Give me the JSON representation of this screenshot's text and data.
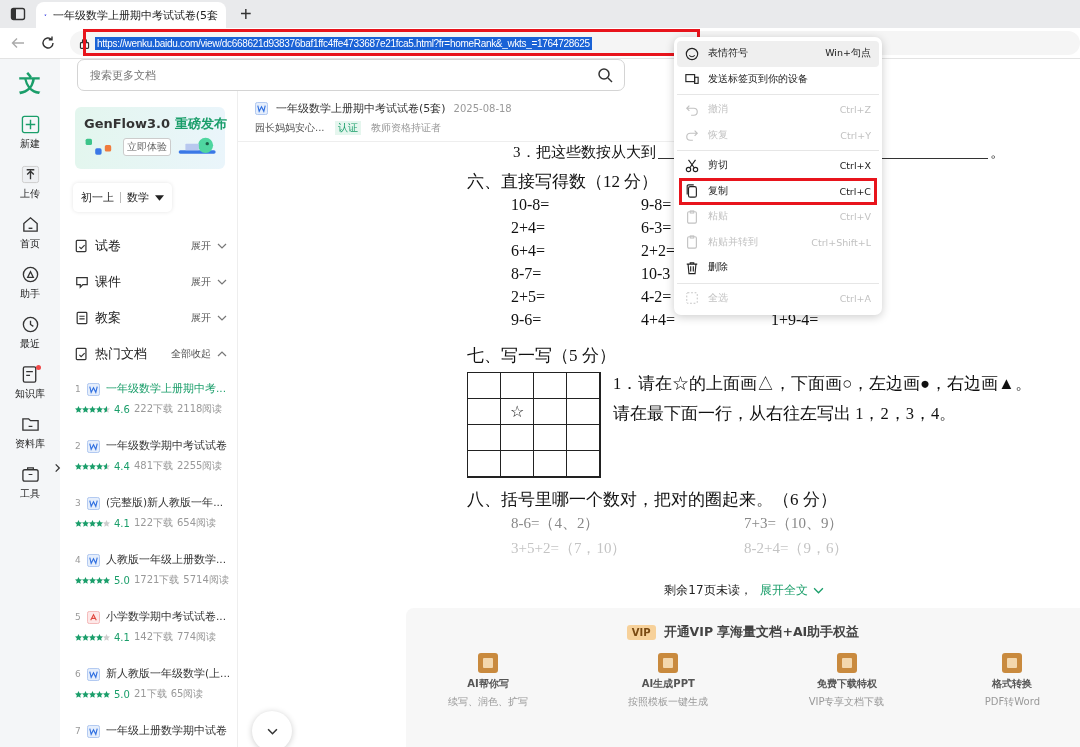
{
  "browser": {
    "tab": {
      "title": "一年级数学上册期中考试试卷(5套"
    },
    "new_tab": "+",
    "address": {
      "url": "https://wenku.baidu.com/view/dc668621d938376baf1ffc4ffe4733687e21fca5.html?fr=homeRank&_wkts_=1764728625",
      "selected": true,
      "annotated": true
    }
  },
  "logo": "文",
  "rail": [
    {
      "label": "新建",
      "dot": false
    },
    {
      "label": "上传",
      "dot": false
    },
    {
      "label": "首页",
      "dot": false
    },
    {
      "label": "助手",
      "dot": false
    },
    {
      "label": "最近",
      "dot": false
    },
    {
      "label": "知识库",
      "dot": true
    },
    {
      "label": "资料库",
      "dot": false
    },
    {
      "label": "工具",
      "dot": false
    }
  ],
  "search": {
    "placeholder": "搜索更多文档"
  },
  "banner": {
    "title": "GenFlow3.0",
    "highlight": "重磅发布",
    "button": "立即体验"
  },
  "filter": {
    "grade": "初一上",
    "subject": "数学"
  },
  "categories": [
    {
      "label": "试卷",
      "action": "展开",
      "expanded": false
    },
    {
      "label": "课件",
      "action": "展开",
      "expanded": false
    },
    {
      "label": "教案",
      "action": "展开",
      "expanded": false
    },
    {
      "label": "热门文档",
      "action": "全部收起",
      "expanded": true
    }
  ],
  "hot_docs": [
    {
      "rank": "1",
      "kind": "word",
      "title": "一年级数学上册期中考...",
      "stars": 4.5,
      "score": "4.6",
      "downloads": "222下载",
      "reads": "2118阅读",
      "selected": true
    },
    {
      "rank": "2",
      "kind": "word",
      "title": "一年级数学期中考试试卷",
      "stars": 4.5,
      "score": "4.4",
      "downloads": "481下载",
      "reads": "2255阅读",
      "selected": false
    },
    {
      "rank": "3",
      "kind": "word",
      "title": "(完整版)新人教版一年...",
      "stars": 4,
      "score": "4.1",
      "downloads": "122下载",
      "reads": "654阅读",
      "selected": false
    },
    {
      "rank": "4",
      "kind": "word",
      "title": "人教版一年级上册数学...",
      "stars": 5,
      "score": "5.0",
      "downloads": "1721下载",
      "reads": "5714阅读",
      "selected": false
    },
    {
      "rank": "5",
      "kind": "pdf",
      "title": "小学数学期中考试试卷...",
      "stars": 4,
      "score": "4.1",
      "downloads": "142下载",
      "reads": "774阅读",
      "selected": false
    },
    {
      "rank": "6",
      "kind": "word",
      "title": "新人教版一年级数学(上...",
      "stars": 5,
      "score": "5.0",
      "downloads": "21下载",
      "reads": "65阅读",
      "selected": false
    },
    {
      "rank": "7",
      "kind": "word",
      "title": "一年级上册数学期中试卷",
      "selected": false
    }
  ],
  "document": {
    "title": "一年级数学上册期中考试试卷(5套)",
    "date": "2025-08-18",
    "author": "园长妈妈安心...",
    "badge": "认证",
    "credential": "教师资格持证者",
    "cut_question": {
      "text": "3．把这些数按从大到",
      "end": "。"
    },
    "arithmetic": {
      "heading": "六、直接写得数（12 分）",
      "rows": [
        [
          "10-8=",
          "9-8="
        ],
        [
          "2+4=",
          "6-3="
        ],
        [
          "6+4=",
          "2+2="
        ],
        [
          "8-7=",
          "10-3"
        ],
        [
          "2+5=",
          "4-2="
        ],
        [
          "9-6=",
          "4+4=",
          "1+9-4="
        ]
      ]
    },
    "drawing": {
      "heading": "七、写一写（5 分）",
      "grid": [
        [
          {
            "kind": "empty"
          },
          {
            "kind": "empty"
          },
          {
            "kind": "empty"
          },
          {
            "kind": "empty"
          }
        ],
        [
          {
            "kind": "empty"
          },
          {
            "kind": "mark",
            "text": "☆"
          },
          {
            "kind": "empty"
          },
          {
            "kind": "empty"
          }
        ],
        [
          {
            "kind": "empty"
          },
          {
            "kind": "empty"
          },
          {
            "kind": "empty"
          },
          {
            "kind": "empty"
          }
        ],
        [
          {
            "kind": "empty"
          },
          {
            "kind": "empty"
          },
          {
            "kind": "empty"
          },
          {
            "kind": "empty"
          }
        ]
      ],
      "lines": [
        "1．请在☆的上面画△，下面画○，左边画●，右边画▲。",
        "请在最下面一行，从右往左写出 1，2，3，4。"
      ]
    },
    "choice": {
      "heading": "八、括号里哪一个数对，把对的圈起来。（6 分）",
      "rows": [
        [
          "8-6=（4、2）",
          "7+3=（10、9）"
        ],
        [
          "3+5+2=（7，10）",
          "8-2+4=（9，6）"
        ]
      ]
    }
  },
  "more": {
    "text": "剩余17页未读，",
    "link": "展开全文"
  },
  "vip": {
    "badge": "VIP",
    "title": "开通VIP 享海量文档+AI助手权益",
    "features": [
      {
        "title": "AI帮你写",
        "subtitle": "续写、润色、扩写"
      },
      {
        "title": "AI生成PPT",
        "subtitle": "按照模板一键生成"
      },
      {
        "title": "免费下载特权",
        "subtitle": "VIP专享文档下载"
      },
      {
        "title": "格式转换",
        "subtitle": "PDF转Word"
      }
    ]
  },
  "context_menu": [
    {
      "kind": "item",
      "label": "表情符号",
      "shortcut": "Win+句点",
      "disabled": false,
      "selected": true,
      "annotated": false
    },
    {
      "kind": "item",
      "label": "发送标签页到你的设备",
      "disabled": false,
      "selected": false,
      "annotated": false
    },
    {
      "kind": "separator"
    },
    {
      "kind": "item",
      "label": "撤消",
      "shortcut": "Ctrl+Z",
      "disabled": true,
      "selected": false,
      "annotated": false
    },
    {
      "kind": "item",
      "label": "恢复",
      "shortcut": "Ctrl+Y",
      "disabled": true,
      "selected": false,
      "annotated": false
    },
    {
      "kind": "separator"
    },
    {
      "kind": "item",
      "label": "剪切",
      "shortcut": "Ctrl+X",
      "disabled": false,
      "selected": false,
      "annotated": false
    },
    {
      "kind": "item",
      "label": "复制",
      "shortcut": "Ctrl+C",
      "disabled": false,
      "selected": false,
      "annotated": true
    },
    {
      "kind": "item",
      "label": "粘贴",
      "shortcut": "Ctrl+V",
      "disabled": true,
      "selected": false,
      "annotated": false
    },
    {
      "kind": "item",
      "label": "粘贴并转到",
      "shortcut": "Ctrl+Shift+L",
      "disabled": true,
      "selected": false,
      "annotated": false
    },
    {
      "kind": "item",
      "label": "删除",
      "disabled": false,
      "selected": false,
      "annotated": false
    },
    {
      "kind": "separator"
    },
    {
      "kind": "item",
      "label": "全选",
      "shortcut": "Ctrl+A",
      "disabled": true,
      "selected": false,
      "annotated": false
    }
  ]
}
